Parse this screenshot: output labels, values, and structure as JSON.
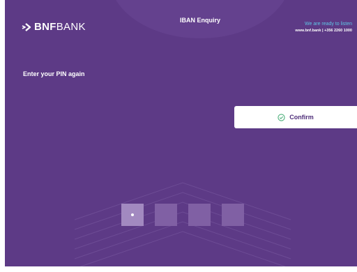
{
  "brand": {
    "bold": "BNF",
    "light": "BANK",
    "logo_icon": "bnf-arrow-mark-icon"
  },
  "screen_title": "IBAN Enquiry",
  "contact": {
    "tagline": "We are ready to listen",
    "line": "www.bnf.bank | +356 2260 1000"
  },
  "instruction": "Enter your PIN again",
  "confirm": {
    "label": "Confirm",
    "icon": "check-circle-icon"
  },
  "pin": {
    "length": 4,
    "entered": 1
  },
  "colors": {
    "background": "#5d3a86",
    "tagline": "#5fc6e6",
    "confirm_text": "#4e2d79",
    "pin_box": "#8060a4",
    "pin_box_active": "#a289c0"
  }
}
